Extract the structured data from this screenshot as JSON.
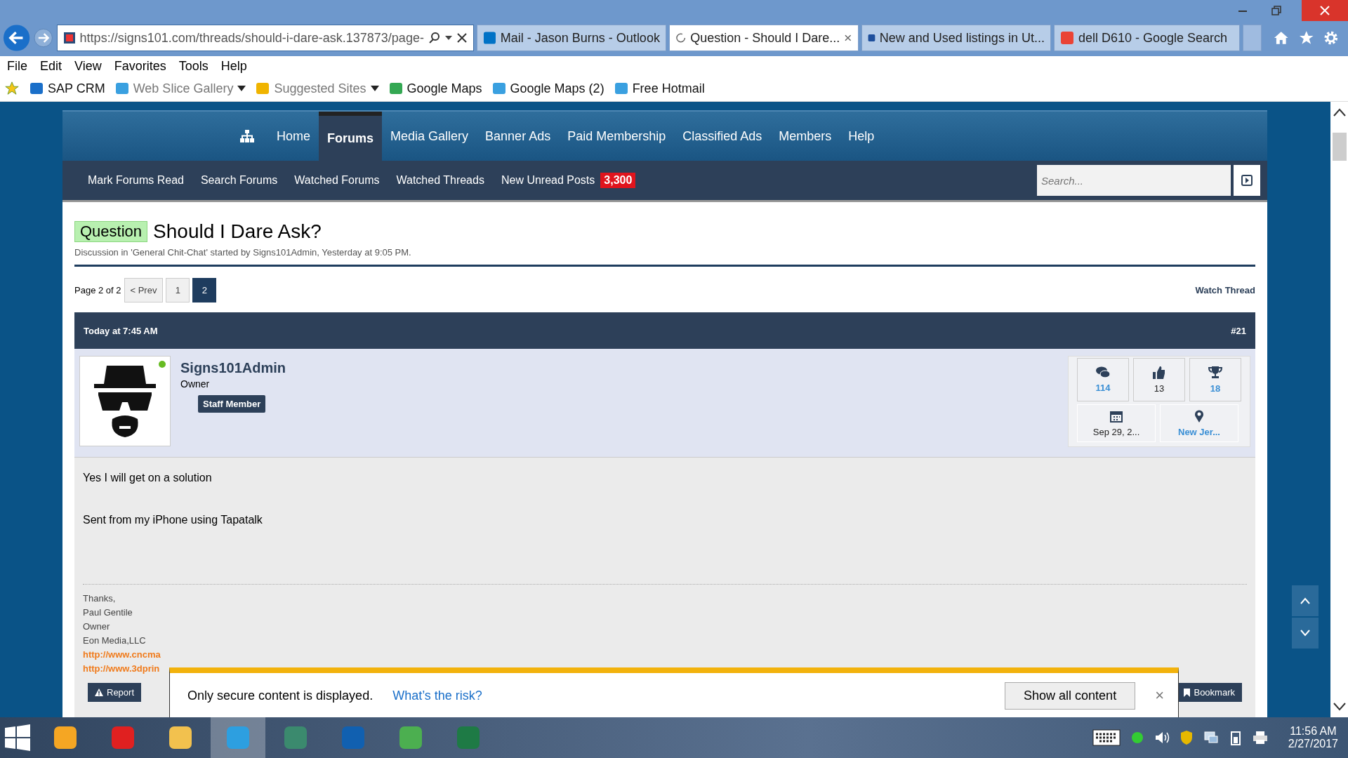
{
  "browser": {
    "address": "https://signs101.com/threads/should-i-dare-ask.137873/page-",
    "tabs": [
      {
        "title": "Mail - Jason Burns - Outlook",
        "selected": false,
        "kind": "mail"
      },
      {
        "title": "Question - Should I Dare...",
        "selected": true,
        "kind": "loading"
      },
      {
        "title": "New and Used listings in Ut...",
        "selected": false,
        "kind": "ksl"
      },
      {
        "title": "dell D610 - Google Search",
        "selected": false,
        "kind": "google"
      }
    ],
    "menu": [
      "File",
      "Edit",
      "View",
      "Favorites",
      "Tools",
      "Help"
    ],
    "favorites": [
      {
        "label": "SAP CRM",
        "kind": "sap",
        "dim": false,
        "dropdown": false
      },
      {
        "label": "Web Slice Gallery",
        "kind": "ie",
        "dim": true,
        "dropdown": true
      },
      {
        "label": "Suggested Sites",
        "kind": "bing",
        "dim": true,
        "dropdown": true
      },
      {
        "label": "Google Maps",
        "kind": "maps",
        "dim": false,
        "dropdown": false
      },
      {
        "label": "Google Maps (2)",
        "kind": "ie",
        "dim": false,
        "dropdown": false
      },
      {
        "label": "Free Hotmail",
        "kind": "ie",
        "dim": false,
        "dropdown": false
      }
    ]
  },
  "nav": {
    "items": [
      {
        "label": "Home",
        "selected": false
      },
      {
        "label": "Forums",
        "selected": true
      },
      {
        "label": "Media Gallery",
        "selected": false
      },
      {
        "label": "Banner Ads",
        "selected": false
      },
      {
        "label": "Paid Membership",
        "selected": false
      },
      {
        "label": "Classified Ads",
        "selected": false
      },
      {
        "label": "Members",
        "selected": false
      },
      {
        "label": "Help",
        "selected": false
      }
    ],
    "subnav": [
      "Mark Forums Read",
      "Search Forums",
      "Watched Forums",
      "Watched Threads",
      "New Unread Posts"
    ],
    "unread_count": "3,300",
    "search_placeholder": "Search..."
  },
  "thread": {
    "prefix": "Question",
    "title": "Should I Dare Ask?",
    "meta": "Discussion in 'General Chit-Chat' started by Signs101Admin, Yesterday at 9:05 PM.",
    "page_label": "Page 2 of 2",
    "prev": "< Prev",
    "pages": [
      {
        "label": "1",
        "selected": false
      },
      {
        "label": "2",
        "selected": true
      }
    ],
    "watch": "Watch Thread"
  },
  "post": {
    "date": "Today at 7:45 AM",
    "number": "#21",
    "username": "Signs101Admin",
    "online": true,
    "role": "Owner",
    "badge": "Staff Member",
    "stats": [
      {
        "kind": "messages",
        "value": "114",
        "link": true
      },
      {
        "kind": "likes",
        "value": "13",
        "link": false
      },
      {
        "kind": "trophy",
        "value": "18",
        "link": true
      }
    ],
    "joined": {
      "value": "Sep 29, 2...",
      "link": false
    },
    "location": {
      "value": "New Jer...",
      "link": true
    },
    "body": [
      "Yes I will get on a solution",
      "Sent from my iPhone using Tapatalk"
    ],
    "signature": [
      "Thanks,",
      "Paul Gentile",
      "Owner",
      "Eon Media,LLC"
    ],
    "links": [
      "http://www.cncma",
      "http://www.3dprin"
    ],
    "report": "Report",
    "bookmark": "Bookmark"
  },
  "notification": {
    "message": "Only secure content is displayed.",
    "link": "What’s the risk?",
    "button": "Show all content",
    "close": "×"
  },
  "taskbar": {
    "apps": [
      {
        "kind": "outlook",
        "selected": false
      },
      {
        "kind": "acrobat",
        "selected": false
      },
      {
        "kind": "explorer",
        "selected": false
      },
      {
        "kind": "ie",
        "selected": true
      },
      {
        "kind": "globe",
        "selected": false
      },
      {
        "kind": "sap",
        "selected": false
      },
      {
        "kind": "chrome",
        "selected": false
      },
      {
        "kind": "excel",
        "selected": false
      }
    ],
    "time": "11:56 AM",
    "date": "2/27/2017"
  }
}
